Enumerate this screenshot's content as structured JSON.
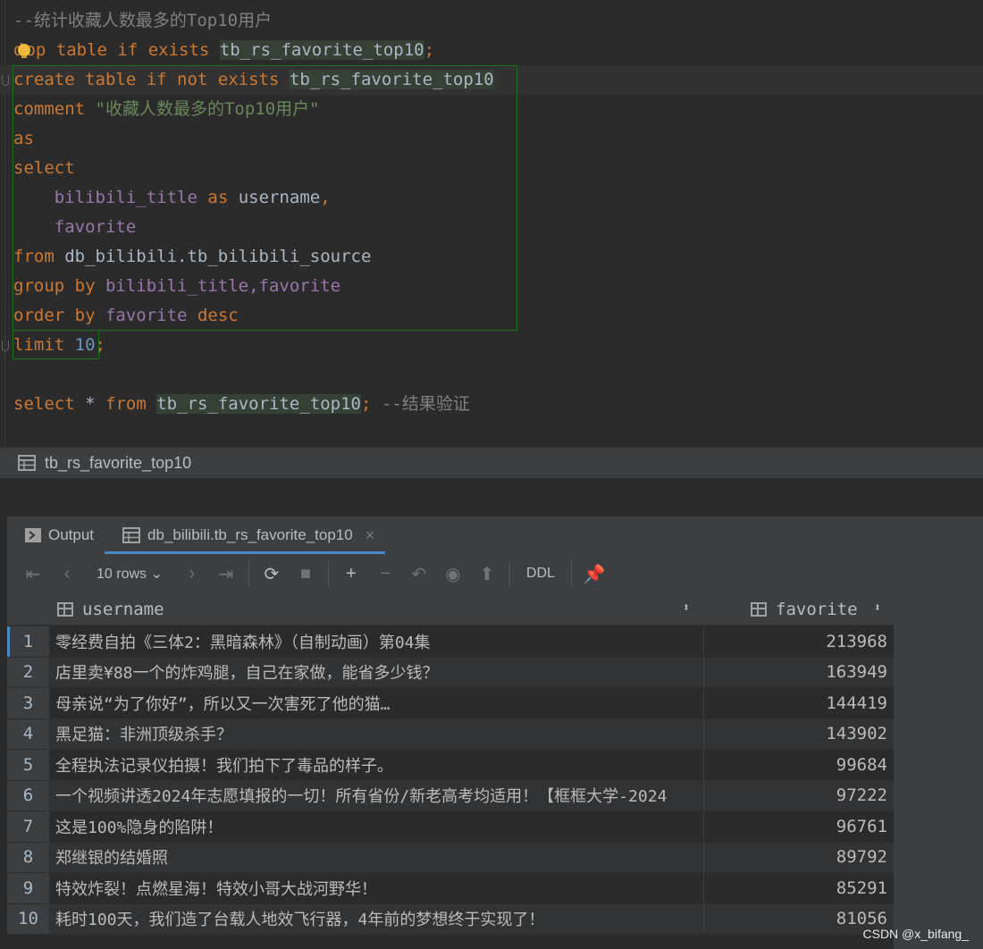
{
  "editor": {
    "comment_line": "--统计收藏人数最多的Top10用户",
    "line_drop": {
      "kw": "drop table if exists",
      "table": "tb_rs_favorite_top10",
      "end": ";"
    },
    "line_create": {
      "kw": "create table if not exists",
      "table": "tb_rs_favorite_top10"
    },
    "line_comment": {
      "kw": "comment",
      "str": "\"收藏人数最多的Top10用户\""
    },
    "line_as": "as",
    "line_select": "select",
    "line_col1": {
      "col": "bilibili_title",
      "kw": "as",
      "alias": "username",
      "comma": ","
    },
    "line_col2": "favorite",
    "line_from": {
      "kw": "from",
      "table": "db_bilibili.tb_bilibili_source"
    },
    "line_group": {
      "kw": "group by",
      "cols": "bilibili_title,favorite"
    },
    "line_order": {
      "kw": "order by",
      "col": "favorite",
      "dir": "desc"
    },
    "line_limit": {
      "kw": "limit",
      "num": "10",
      "end": ";"
    },
    "line_verify": {
      "kw1": "select",
      "star": "*",
      "kw2": "from",
      "table": "tb_rs_favorite_top10",
      "end": ";",
      "comment": "--结果验证"
    }
  },
  "result_title": "tb_rs_favorite_top10",
  "tabs": [
    {
      "label": "Output",
      "icon": "console-icon"
    },
    {
      "label": "db_bilibili.tb_rs_favorite_top10",
      "icon": "table-icon"
    }
  ],
  "toolbar": {
    "rows_label": "10 rows",
    "ddl_label": "DDL"
  },
  "grid": {
    "columns": [
      "username",
      "favorite"
    ],
    "rows": [
      {
        "n": "1",
        "username": "零经费自拍《三体2：黑暗森林》（自制动画）第04集",
        "favorite": "213968"
      },
      {
        "n": "2",
        "username": "店里卖¥88一个的炸鸡腿，自己在家做，能省多少钱？",
        "favorite": "163949"
      },
      {
        "n": "3",
        "username": "母亲说“为了你好”，所以又一次害死了他的猫…",
        "favorite": "144419"
      },
      {
        "n": "4",
        "username": "黑足猫：非洲顶级杀手？",
        "favorite": "143902"
      },
      {
        "n": "5",
        "username": "全程执法记录仪拍摄！我们拍下了毒品的样子。",
        "favorite": "99684"
      },
      {
        "n": "6",
        "username": "一个视频讲透2024年志愿填报的一切！所有省份/新老高考均适用！【框框大学-2024",
        "favorite": "97222"
      },
      {
        "n": "7",
        "username": "这是100%隐身的陷阱！",
        "favorite": "96761"
      },
      {
        "n": "8",
        "username": "郑继银的结婚照",
        "favorite": "89792"
      },
      {
        "n": "9",
        "username": "特效炸裂！点燃星海！特效小哥大战河野华！",
        "favorite": "85291"
      },
      {
        "n": "10",
        "username": "耗时100天，我们造了台载人地效飞行器，4年前的梦想终于实现了！",
        "favorite": "81056"
      }
    ]
  },
  "watermark": "CSDN @x_bifang_"
}
